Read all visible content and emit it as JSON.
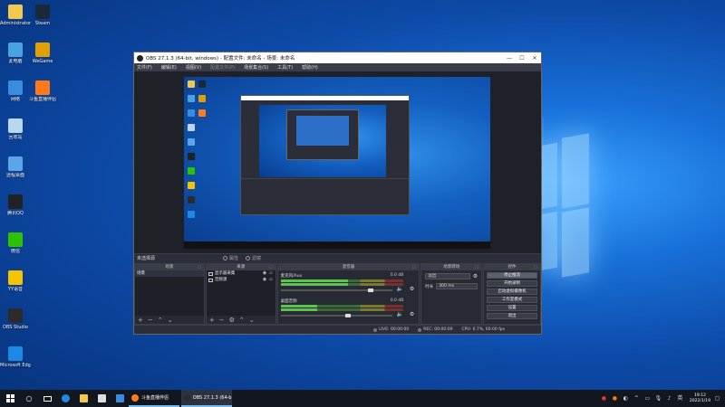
{
  "desktop": {
    "icons_left": [
      {
        "label": "Administrator",
        "color": "#f2c94c"
      },
      {
        "label": "此电脑",
        "color": "#4aa3df"
      },
      {
        "label": "网络",
        "color": "#3a8dde"
      },
      {
        "label": "回收站",
        "color": "#b9d7ee"
      },
      {
        "label": "远程桌面",
        "color": "#5aa7e8"
      },
      {
        "label": "腾讯QQ",
        "color": "#222222"
      },
      {
        "label": "微信",
        "color": "#2dc100"
      },
      {
        "label": "YY语音",
        "color": "#f5c400"
      },
      {
        "label": "OBS Studio",
        "color": "#2b2b2b"
      },
      {
        "label": "Microsoft Edge",
        "color": "#1e88e5"
      }
    ],
    "icons_right": [
      {
        "label": "Steam",
        "color": "#1b2838"
      },
      {
        "label": "WeGame",
        "color": "#e0a000"
      },
      {
        "label": "斗鱼直播伴侣",
        "color": "#ff7a1a"
      }
    ]
  },
  "obs": {
    "title": "OBS 27.1.3 (64-bit, windows) - 配置文件: 未命名 - 场景: 未命名",
    "window_buttons": [
      "—",
      "☐",
      "✕"
    ],
    "menu": [
      {
        "label": "文件(F)",
        "dim": false
      },
      {
        "label": "编辑(E)",
        "dim": false
      },
      {
        "label": "视图(V)",
        "dim": false
      },
      {
        "label": "配置文件(P)",
        "dim": true
      },
      {
        "label": "场景集合(S)",
        "dim": false
      },
      {
        "label": "工具(T)",
        "dim": false
      },
      {
        "label": "帮助(H)",
        "dim": false
      }
    ],
    "scene_bar": {
      "label": "未选择源",
      "btn_props": "属性",
      "btn_filters": "滤镜"
    },
    "scenes": {
      "header": "场景",
      "items": [
        "场景"
      ]
    },
    "sources": {
      "header": "来源",
      "items": [
        "显示器采集",
        "音频源"
      ]
    },
    "mixer": {
      "header": "混音器",
      "channels": [
        {
          "name": "麦克风/Aux",
          "db": "0.0 dB",
          "level": 0.55,
          "volume": 0.8
        },
        {
          "name": "桌面音频",
          "db": "0.0 dB",
          "level": 0.3,
          "volume": 0.6
        }
      ]
    },
    "transitions": {
      "header": "场景转场",
      "type": "淡出",
      "duration_label": "时长",
      "duration": "300 ms"
    },
    "controls": {
      "header": "控件",
      "buttons": [
        "停止推流",
        "开始录制",
        "启动虚拟摄像机",
        "工作室模式",
        "设置",
        "退出"
      ]
    },
    "status": {
      "live": "LIVE: 00:00:00",
      "rec": "REC: 00:00:00",
      "cpu": "CPU: 0.7%, 60.00 fps"
    }
  },
  "taskbar": {
    "apps": [
      {
        "label": "斗鱼直播伴侣",
        "color": "#ff7a1a",
        "active": false
      },
      {
        "label": "OBS 27.1.3 (64-bit...",
        "color": "#2b2b2b",
        "active": true
      }
    ],
    "time": "19:12",
    "date": "2022/1/19"
  }
}
